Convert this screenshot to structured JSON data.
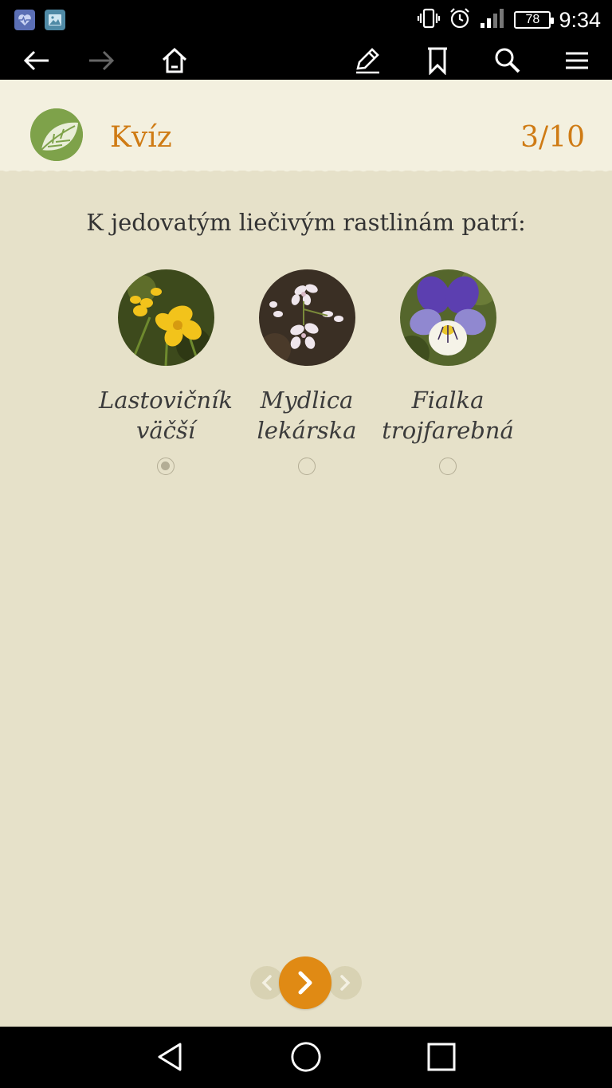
{
  "status_bar": {
    "time": "9:34",
    "battery": "78",
    "icons": [
      "health-app-icon",
      "gallery-icon",
      "vibrate-icon",
      "alarm-icon",
      "signal-icon",
      "battery-icon"
    ]
  },
  "toolbar": {
    "icons": [
      "back-arrow-icon",
      "forward-arrow-icon",
      "home-icon",
      "pencil-icon",
      "bookmark-icon",
      "search-icon",
      "menu-icon"
    ]
  },
  "header": {
    "title": "Kvíz",
    "counter": "3/10"
  },
  "quiz": {
    "question": "K jedovatým liečivým rastlinám patrí:",
    "options": [
      {
        "line1": "Lastovičník",
        "line2": "väčší",
        "selected": true
      },
      {
        "line1": "Mydlica",
        "line2": "lekárska",
        "selected": false
      },
      {
        "line1": "Fialka",
        "line2": "trojfarebná",
        "selected": false
      }
    ]
  },
  "colors": {
    "accent": "#e08a14",
    "title": "#cf7b14",
    "background": "#e6e1c9",
    "header_bg": "#f3f0df",
    "logo_green": "#7ea24a"
  }
}
